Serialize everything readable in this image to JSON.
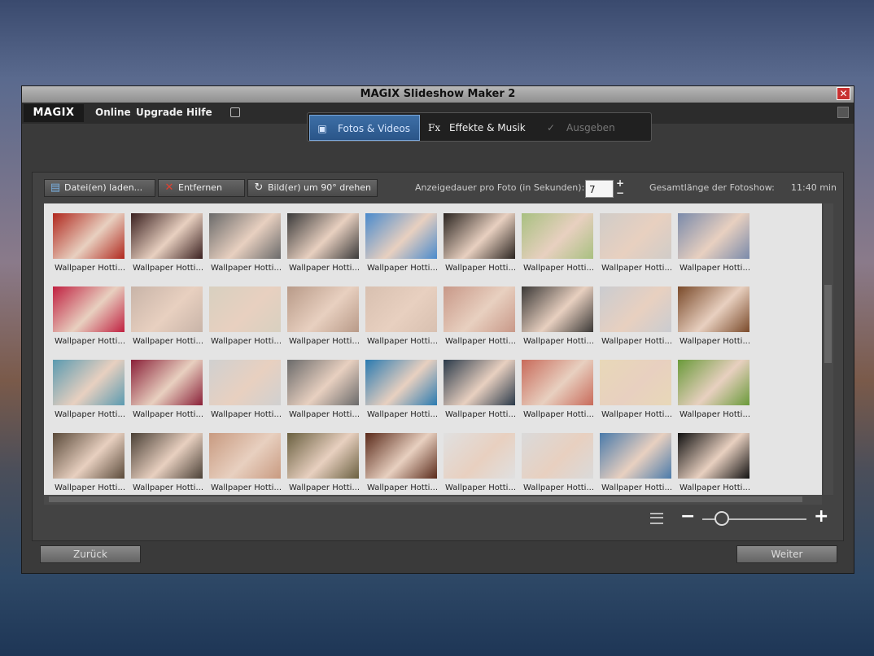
{
  "window": {
    "title": "MAGIX Slideshow Maker 2",
    "close_glyph": "✕"
  },
  "menubar": {
    "logo": "MAGIX",
    "items": [
      "Online",
      "Upgrade",
      "Hilfe"
    ]
  },
  "tabs": [
    {
      "label": "Fotos & Videos",
      "icon": "monitor-icon",
      "state": "active"
    },
    {
      "label": "Effekte & Musik",
      "icon": "fx-icon",
      "state": "normal"
    },
    {
      "label": "Ausgeben",
      "icon": "check-icon",
      "state": "disabled"
    }
  ],
  "toolbar": {
    "load_label": "Datei(en) laden...",
    "remove_label": "Entfernen",
    "rotate_label": "Bild(er) um 90° drehen",
    "duration_label": "Anzeigedauer pro Foto (in Sekunden):",
    "duration_value": "7",
    "spin_up": "+",
    "spin_down": "−",
    "total_label": "Gesamtlänge der Fotoshow:",
    "total_value": "11:40 min"
  },
  "thumbnails": {
    "caption": "Wallpaper Hotti...",
    "rows": 4,
    "columns": 9,
    "colors": [
      [
        "#b0281e",
        "#3a2020",
        "#6a6a6a",
        "#3a3a3a",
        "#4a8acc",
        "#2a2420",
        "#a8c080",
        "#d0ccc8",
        "#7a8aaa"
      ],
      [
        "#c02040",
        "#c8b4a8",
        "#d8d0c0",
        "#b89a88",
        "#d8c0b0",
        "#c89888",
        "#3a3836",
        "#caccd0",
        "#7a4a2a"
      ],
      [
        "#5a9ab0",
        "#8a2038",
        "#d0d0d0",
        "#6a6a6a",
        "#2a7ab0",
        "#2a3a4a",
        "#c86a5a",
        "#e8d8b8",
        "#6a9a3a"
      ],
      [
        "#5a4a3a",
        "#4a4036",
        "#c89a80",
        "#6a6040",
        "#5a2a1a",
        "#e0e0e0",
        "#dadada",
        "#4a7aaa",
        "#111111"
      ]
    ]
  },
  "bottom": {
    "back_label": "Zurück",
    "next_label": "Weiter"
  },
  "colors": {
    "accent": "#2a5589",
    "panel": "#3a3a3a",
    "grid_bg": "#e4e4e4"
  }
}
